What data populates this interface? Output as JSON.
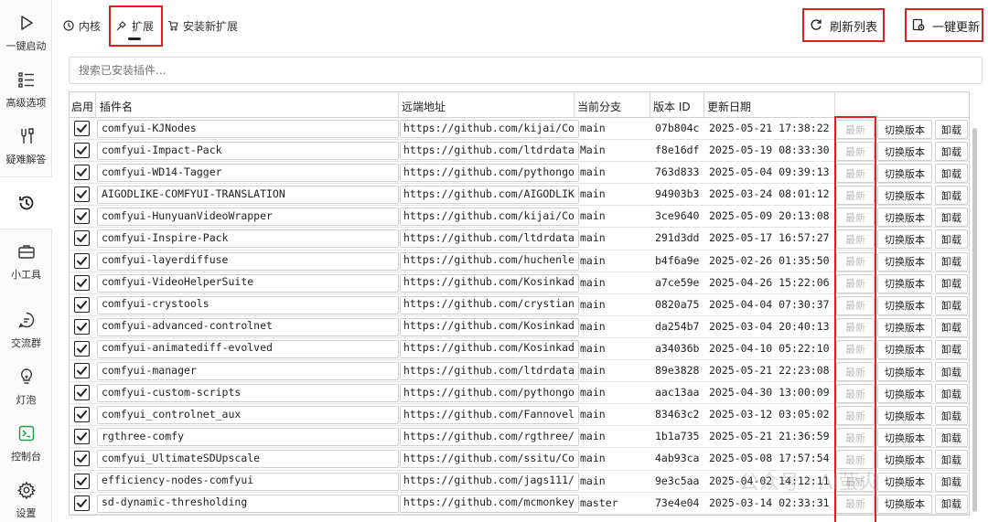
{
  "sidebar": {
    "items": [
      {
        "label": "一键启动",
        "icon": "play-icon"
      },
      {
        "label": "高级选项",
        "icon": "list-icon"
      },
      {
        "label": "疑难解答",
        "icon": "tools-icon"
      },
      {
        "label": "",
        "icon": "history-icon"
      },
      {
        "label": "小工具",
        "icon": "toolbox-icon"
      },
      {
        "label": "交流群",
        "icon": "chat-icon"
      },
      {
        "label": "灯泡",
        "icon": "bulb-icon"
      },
      {
        "label": "控制台",
        "icon": "terminal-icon"
      },
      {
        "label": "设置",
        "icon": "gear-icon"
      }
    ]
  },
  "tabs": {
    "kernel": "内核",
    "extensions": "扩展",
    "install": "安装新扩展"
  },
  "actions": {
    "refresh": "刷新列表",
    "update_all": "一键更新"
  },
  "search": {
    "placeholder": "搜索已安装插件..."
  },
  "table": {
    "headers": {
      "enabled": "启用",
      "name": "插件名",
      "url": "远端地址",
      "branch": "当前分支",
      "version": "版本 ID",
      "date": "更新日期"
    },
    "buttons": {
      "latest": "最新",
      "switch": "切换版本",
      "uninstall": "卸载"
    },
    "rows": [
      {
        "name": "comfyui-KJNodes",
        "url": "https://github.com/kijai/Co",
        "branch": "main",
        "version": "07b804c",
        "date": "2025-05-21 17:38:22"
      },
      {
        "name": "comfyui-Impact-Pack",
        "url": "https://github.com/ltdrdata",
        "branch": "Main",
        "version": "f8e16df",
        "date": "2025-05-19 08:33:30"
      },
      {
        "name": "comfyui-WD14-Tagger",
        "url": "https://github.com/pythongo",
        "branch": "main",
        "version": "763d833",
        "date": "2025-05-04 09:39:13"
      },
      {
        "name": "AIGODLIKE-COMFYUI-TRANSLATION",
        "url": "https://github.com/AIGODLIK",
        "branch": "main",
        "version": "94903b3",
        "date": "2025-03-24 08:01:12"
      },
      {
        "name": "comfyui-HunyuanVideoWrapper",
        "url": "https://github.com/kijai/Co",
        "branch": "main",
        "version": "3ce9640",
        "date": "2025-05-09 20:13:08"
      },
      {
        "name": "comfyui-Inspire-Pack",
        "url": "https://github.com/ltdrdata",
        "branch": "main",
        "version": "291d3dd",
        "date": "2025-05-17 16:57:27"
      },
      {
        "name": "comfyui-layerdiffuse",
        "url": "https://github.com/huchenle",
        "branch": "main",
        "version": "b4f6a9e",
        "date": "2025-02-26 01:35:50"
      },
      {
        "name": "comfyui-VideoHelperSuite",
        "url": "https://github.com/Kosinkad",
        "branch": "main",
        "version": "a7ce59e",
        "date": "2025-04-26 15:22:06"
      },
      {
        "name": "comfyui-crystools",
        "url": "https://github.com/crystian",
        "branch": "main",
        "version": "0820a75",
        "date": "2025-04-04 07:30:37"
      },
      {
        "name": "comfyui-advanced-controlnet",
        "url": "https://github.com/Kosinkad",
        "branch": "main",
        "version": "da254b7",
        "date": "2025-03-04 20:40:13"
      },
      {
        "name": "comfyui-animatediff-evolved",
        "url": "https://github.com/Kosinkad",
        "branch": "main",
        "version": "a34036b",
        "date": "2025-04-10 05:22:10"
      },
      {
        "name": "comfyui-manager",
        "url": "https://github.com/ltdrdata",
        "branch": "main",
        "version": "89e3828",
        "date": "2025-05-21 22:23:08"
      },
      {
        "name": "comfyui-custom-scripts",
        "url": "https://github.com/pythongo",
        "branch": "main",
        "version": "aac13aa",
        "date": "2025-04-30 13:00:09"
      },
      {
        "name": "comfyui_controlnet_aux",
        "url": "https://github.com/Fannovel",
        "branch": "main",
        "version": "83463c2",
        "date": "2025-03-12 03:05:02"
      },
      {
        "name": "rgthree-comfy",
        "url": "https://github.com/rgthree/",
        "branch": "main",
        "version": "1b1a735",
        "date": "2025-05-21 21:36:59"
      },
      {
        "name": "comfyui_UltimateSDUpscale",
        "url": "https://github.com/ssitu/Co",
        "branch": "main",
        "version": "4ab93ca",
        "date": "2025-05-08 17:57:54"
      },
      {
        "name": "efficiency-nodes-comfyui",
        "url": "https://github.com/jags111/",
        "branch": "main",
        "version": "9e3c5aa",
        "date": "2025-04-02 14:12:11"
      },
      {
        "name": "sd-dynamic-thresholding",
        "url": "https://github.com/mcmonkey",
        "branch": "master",
        "version": "73e4e04",
        "date": "2025-03-14 02:33:31"
      }
    ]
  },
  "watermark": "公众号 · AI萤火",
  "colors": {
    "highlight": "#e02020",
    "console_green": "#1f9a4a"
  }
}
